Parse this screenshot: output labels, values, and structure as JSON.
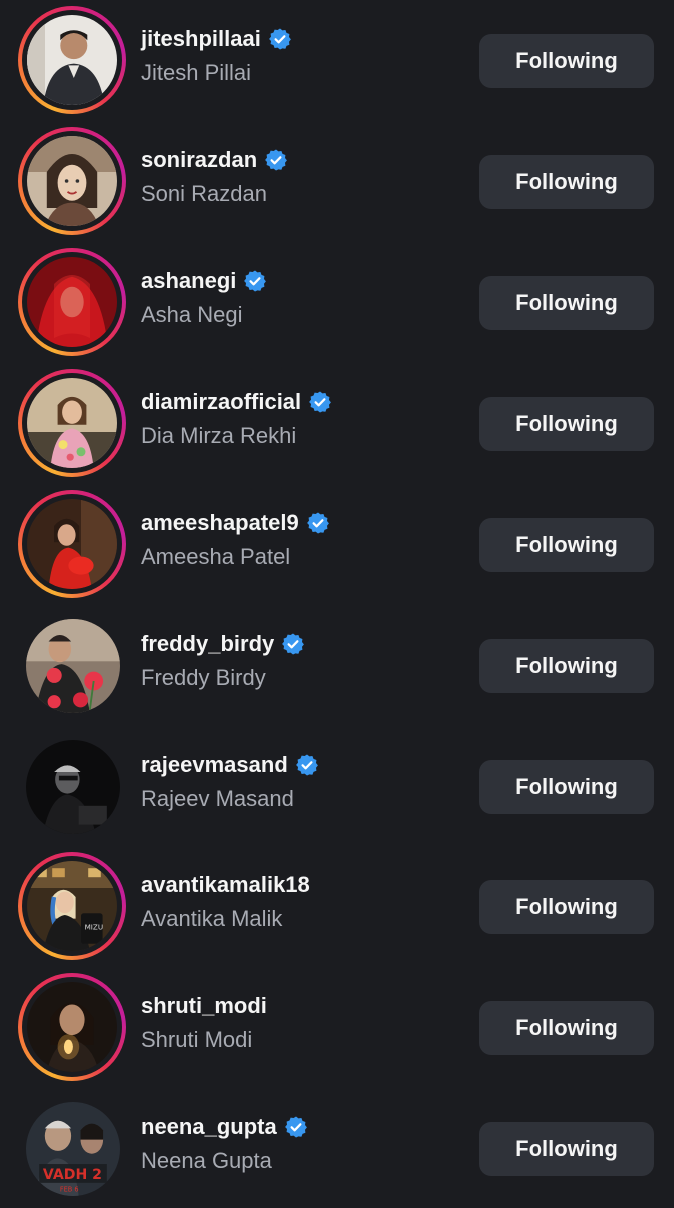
{
  "following_list": [
    {
      "username": "jiteshpillaai",
      "name": "Jitesh Pillai",
      "verified": true,
      "story_ring": true,
      "button": "Following"
    },
    {
      "username": "sonirazdan",
      "name": "Soni Razdan",
      "verified": true,
      "story_ring": true,
      "button": "Following"
    },
    {
      "username": "ashanegi",
      "name": "Asha Negi",
      "verified": true,
      "story_ring": true,
      "button": "Following"
    },
    {
      "username": "diamirzaofficial",
      "name": "Dia Mirza Rekhi",
      "verified": true,
      "story_ring": true,
      "button": "Following"
    },
    {
      "username": "ameeshapatel9",
      "name": "Ameesha Patel",
      "verified": true,
      "story_ring": true,
      "button": "Following"
    },
    {
      "username": "freddy_birdy",
      "name": "Freddy Birdy",
      "verified": true,
      "story_ring": false,
      "button": "Following"
    },
    {
      "username": "rajeevmasand",
      "name": "Rajeev Masand",
      "verified": true,
      "story_ring": false,
      "button": "Following"
    },
    {
      "username": "avantikamalik18",
      "name": "Avantika Malik",
      "verified": false,
      "story_ring": true,
      "button": "Following"
    },
    {
      "username": "shruti_modi",
      "name": "Shruti Modi",
      "verified": false,
      "story_ring": true,
      "button": "Following"
    },
    {
      "username": "neena_gupta",
      "name": "Neena Gupta",
      "verified": true,
      "story_ring": false,
      "button": "Following"
    }
  ],
  "colors": {
    "background": "#1b1c20",
    "button_bg": "#2f3239",
    "verified_blue": "#3897f0",
    "secondary_text": "#a8abb3"
  }
}
